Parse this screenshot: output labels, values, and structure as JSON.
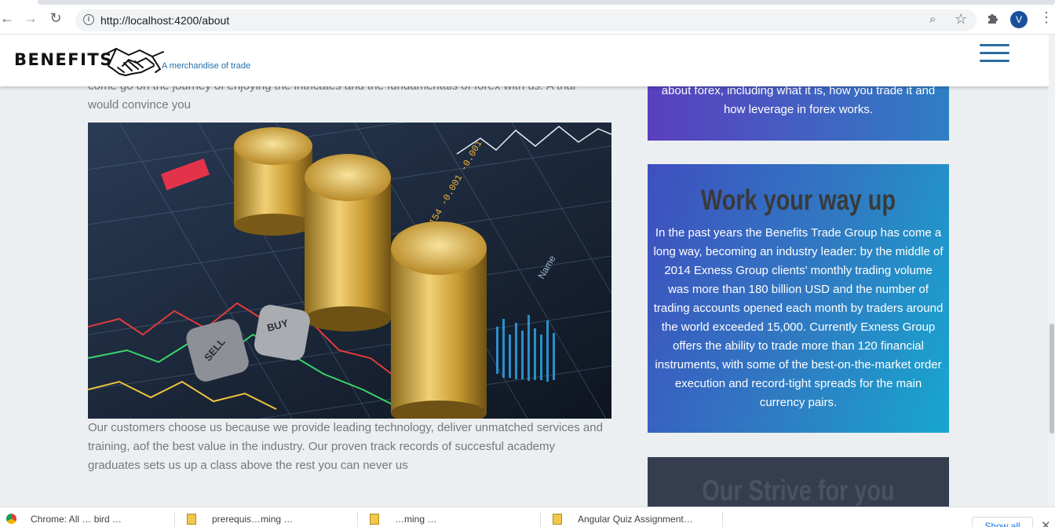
{
  "browser": {
    "url": "http://localhost:4200/about",
    "profile_initial": "V"
  },
  "header": {
    "brand": "BENEFITS",
    "tagline": "A merchandise of trade"
  },
  "main": {
    "intro_partial": "come go on the journey of enjoying the intricates and the fundamentals of forex with us. A trial would convince you",
    "body": "Our customers choose us because we provide leading technology, deliver unmatched services and training, aof the best value in the industry. Our proven track records of succesful academy graduates sets us up a class above the rest you can never us"
  },
  "sidebar": {
    "card1_text": "about forex, including what it is, how you trade it and how leverage in forex works.",
    "card2": {
      "heading": "Work your way up",
      "text": "In the past years the Benefits Trade Group has come a long way, becoming an industry leader: by the middle of 2014 Exness Group clients' monthly trading volume was more than 180 billion USD and the number of trading accounts opened each month by traders around the world exceeded 15,000. Currently Exness Group offers the ability to trade more than 120 financial instruments, with some of the best-on-the-market order execution and record-tight spreads for the main currency pairs."
    },
    "card3": {
      "heading": "Our Strive for you"
    }
  },
  "downloads": {
    "items": [
      "Chrome: All … bird …",
      "prerequis…ming …",
      "…ming …",
      "Angular Quiz Assignment…"
    ],
    "show_all": "Show all"
  },
  "colors": {
    "accent": "#2a6da3",
    "card_gradient_start": "#5a3fbf",
    "card_gradient_end": "#17a7cf",
    "dark_card": "#363d4e"
  }
}
